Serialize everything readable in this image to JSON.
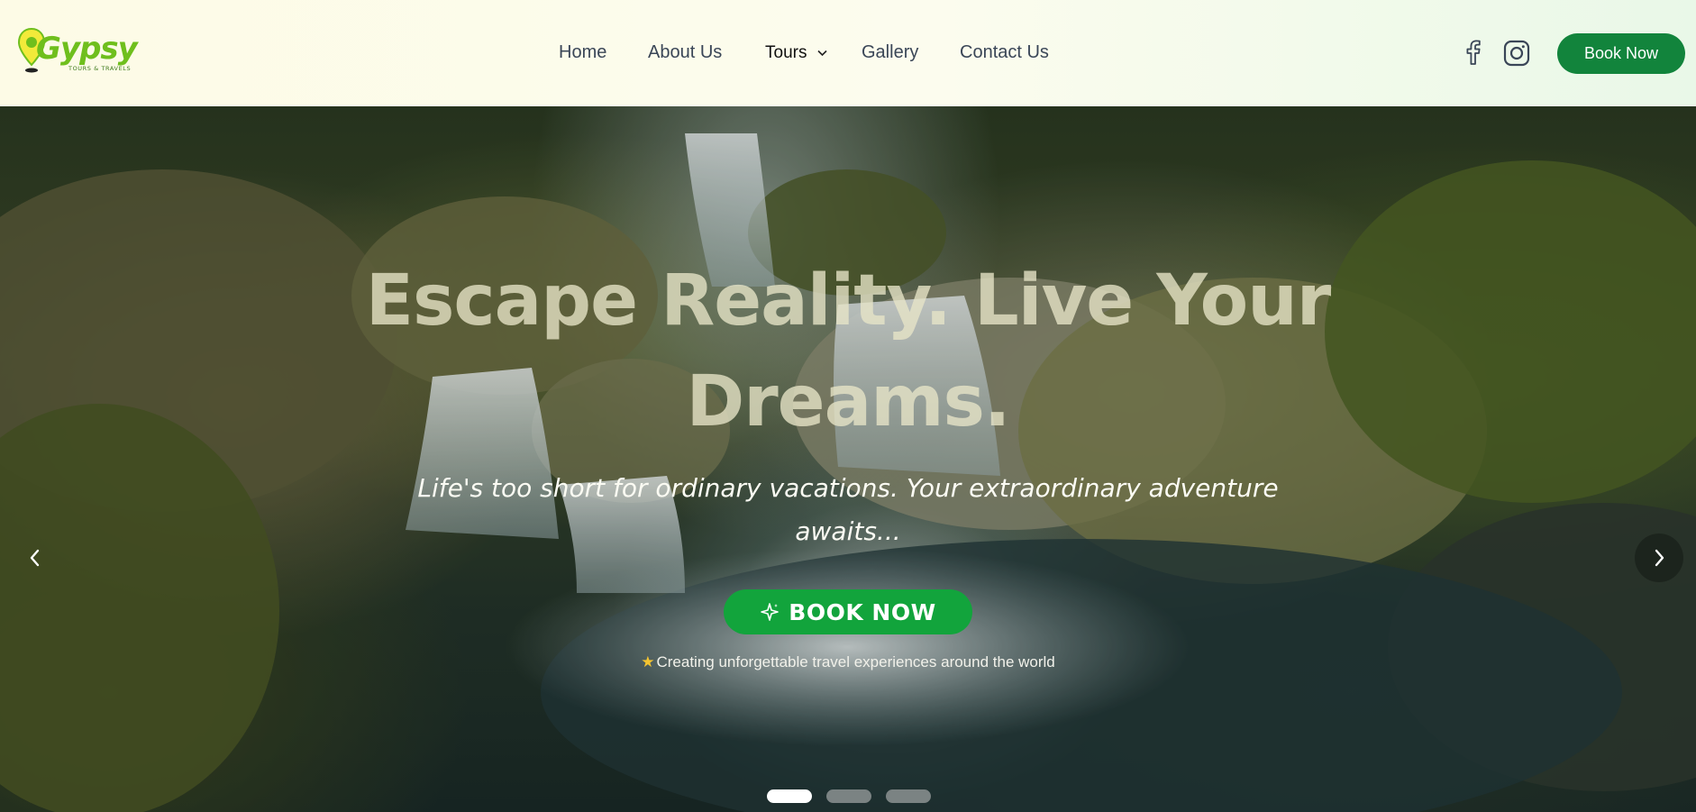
{
  "brand": {
    "name": "Gypsy",
    "tagline": "TOURS & TRAVELS"
  },
  "nav": {
    "items": [
      {
        "label": "Home"
      },
      {
        "label": "About Us"
      },
      {
        "label": "Tours"
      },
      {
        "label": "Gallery"
      },
      {
        "label": "Contact Us"
      }
    ]
  },
  "header": {
    "social": [
      "facebook-icon",
      "instagram-icon"
    ],
    "book_label": "Book Now"
  },
  "hero": {
    "title_line1": "Escape Reality. Live Your",
    "title_line2": "Dreams.",
    "subtitle_line1": "Life's too short for ordinary vacations. Your extraordinary adventure",
    "subtitle_line2": "awaits...",
    "cta_label": "BOOK NOW",
    "tagline": "Creating unforgettable travel experiences around the world",
    "slide_count": 3,
    "active_slide": 1
  },
  "colors": {
    "brand_green": "#12843c",
    "cta_green": "#12a43c",
    "logo_green": "#6fbf1d",
    "star_gold": "#f4c431"
  }
}
